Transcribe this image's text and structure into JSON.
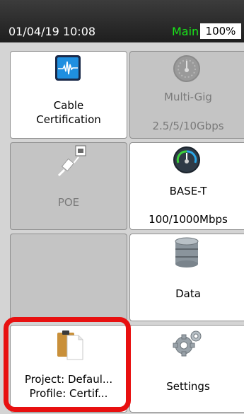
{
  "status": {
    "datetime": "01/04/19 10:08",
    "mode": "Main",
    "battery": "100%"
  },
  "tiles": {
    "cable": {
      "line1": "Cable",
      "line2": "Certification"
    },
    "multigig": {
      "line1": "Multi-Gig",
      "line2": "2.5/5/10Gbps"
    },
    "poe": {
      "label": "POE"
    },
    "baset": {
      "line1": "BASE-T",
      "line2": "100/1000Mbps"
    },
    "data": {
      "label": "Data"
    },
    "project": {
      "line1": "Project: Defaul...",
      "line2": "Profile: Certif..."
    },
    "settings": {
      "label": "Settings"
    }
  },
  "colors": {
    "mode_green": "#19e619",
    "highlight_red": "#e81010"
  }
}
